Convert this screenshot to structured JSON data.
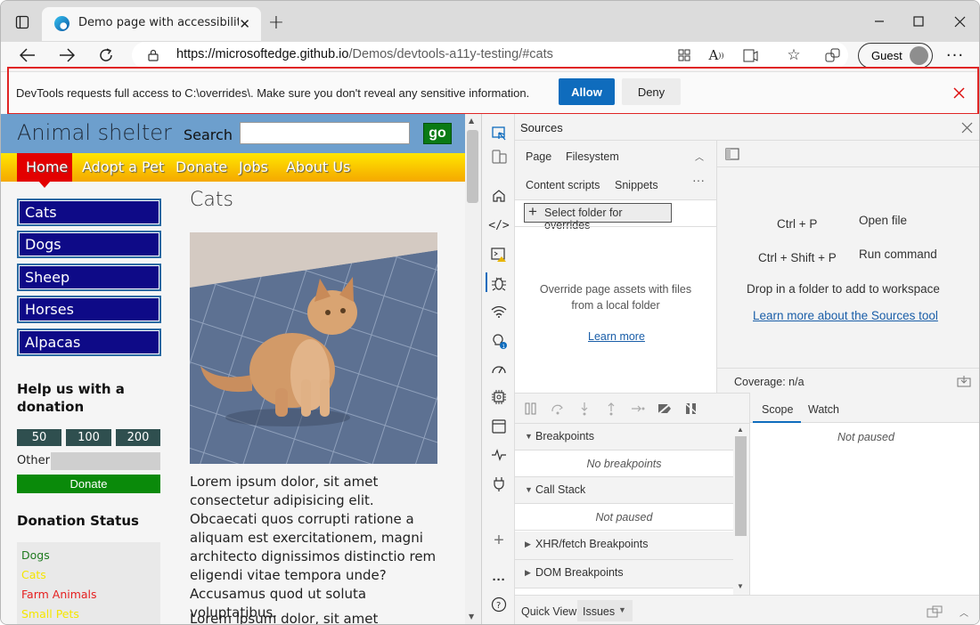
{
  "browser": {
    "tab_title": "Demo page with accessibility issu",
    "url_host": "https://microsoftedge.github.io",
    "url_path": "/Demos/devtools-a11y-testing/#cats",
    "profile_label": "Guest"
  },
  "infobar": {
    "message": "DevTools requests full access to C:\\overrides\\. Make sure you don't reveal any sensitive information.",
    "allow_label": "Allow",
    "deny_label": "Deny"
  },
  "site": {
    "brand": "Animal shelter",
    "search_label": "Search",
    "search_value": "",
    "go_label": "go",
    "nav": [
      "Home",
      "Adopt a Pet",
      "Donate",
      "Jobs",
      "About Us"
    ],
    "animals": [
      "Cats",
      "Dogs",
      "Sheep",
      "Horses",
      "Alpacas"
    ],
    "donation_heading": "Help us with a donation",
    "amounts": [
      "50",
      "100",
      "200"
    ],
    "other_label": "Other",
    "donate_label": "Donate",
    "status_heading": "Donation Status",
    "status_items": [
      {
        "label": "Dogs",
        "color": "#1f7a1f"
      },
      {
        "label": "Cats",
        "color": "#f5e600"
      },
      {
        "label": "Farm Animals",
        "color": "#e52020"
      },
      {
        "label": "Small Pets",
        "color": "#f5e600"
      }
    ],
    "page_heading": "Cats",
    "lorem1": "Lorem ipsum dolor, sit amet consectetur adipisicing elit. Obcaecati quos corrupti ratione a aliquam est exercitationem, magni architecto dignissimos distinctio rem eligendi vitae tempora unde? Accusamus quod ut soluta voluptatibus.",
    "lorem2": "Lorem ipsum dolor, sit amet"
  },
  "devtools": {
    "panel_title": "Sources",
    "nav_tabs": [
      "Page",
      "Filesystem",
      "Content scripts",
      "Snippets"
    ],
    "select_folder_label": "Select folder for overrides",
    "override_text": "Override page assets with files from a local folder",
    "learn_more": "Learn more",
    "shortcuts": [
      {
        "keys": "Ctrl + P",
        "action": "Open file"
      },
      {
        "keys": "Ctrl + Shift + P",
        "action": "Run command"
      }
    ],
    "drop_text": "Drop in a folder to add to workspace",
    "learn_sources": "Learn more about the Sources tool",
    "coverage": "Coverage: n/a",
    "sections": [
      {
        "title": "Breakpoints",
        "expanded": true,
        "empty": "No breakpoints"
      },
      {
        "title": "Call Stack",
        "expanded": true,
        "empty": "Not paused"
      },
      {
        "title": "XHR/fetch Breakpoints",
        "expanded": false
      },
      {
        "title": "DOM Breakpoints",
        "expanded": false
      }
    ],
    "scope_tabs": [
      "Scope",
      "Watch"
    ],
    "scope_empty": "Not paused",
    "quick_view_label": "Quick View:",
    "quick_view_value": "Issues"
  }
}
